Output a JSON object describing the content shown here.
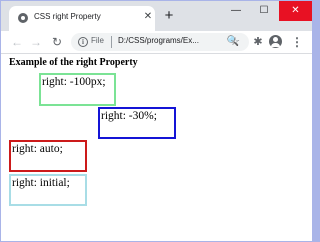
{
  "browser": {
    "tab": {
      "title": "CSS right Property",
      "close": "✕",
      "icon": "globe-icon"
    },
    "new_tab": "+",
    "window_controls": {
      "minimize": "—",
      "maximize": "☐",
      "close": "✕"
    },
    "nav": {
      "back": "←",
      "forward": "→",
      "reload": "↻"
    },
    "address": {
      "scheme_label": "File",
      "url": "D:/CSS/programs/Ex...",
      "info": "i",
      "zoom": "🔍"
    },
    "actions": {
      "star": "☆",
      "extensions": "✱",
      "menu": "⋮"
    }
  },
  "page": {
    "heading": "Example of the right Property",
    "boxes": [
      {
        "text": "right: -100px;",
        "border_color": "#7be395"
      },
      {
        "text": "right: -30%;",
        "border_color": "#1414d6"
      },
      {
        "text": "right: auto;",
        "border_color": "#cc1a1a"
      },
      {
        "text": "right: initial;",
        "border_color": "#a8dde6"
      }
    ]
  }
}
